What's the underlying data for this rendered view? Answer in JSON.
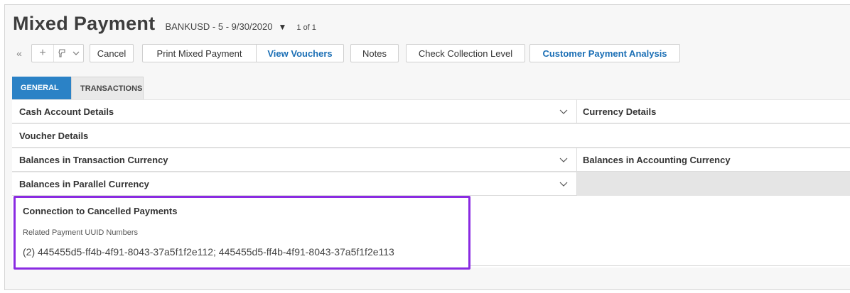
{
  "header": {
    "title": "Mixed Payment",
    "doc_ref": "BANKUSD - 5 - 9/30/2020",
    "doc_caret": "▼",
    "record_count": "1 of 1"
  },
  "toolbar": {
    "collapse_glyph": "«",
    "add_glyph": "+",
    "cancel": "Cancel",
    "print_mixed_payment": "Print Mixed Payment",
    "view_vouchers": "View Vouchers",
    "notes": "Notes",
    "check_collection_level": "Check Collection Level",
    "customer_payment_analysis": "Customer Payment Analysis"
  },
  "tabs": [
    {
      "label": "GENERAL",
      "active": true
    },
    {
      "label": "TRANSACTIONS",
      "active": false
    }
  ],
  "sections": {
    "cash_account_details": "Cash Account Details",
    "currency_details": "Currency Details",
    "voucher_details": "Voucher Details",
    "balances_transaction_currency": "Balances in Transaction Currency",
    "balances_accounting_currency": "Balances in Accounting Currency",
    "balances_parallel_currency": "Balances in Parallel Currency",
    "connection_cancelled_payments": "Connection to Cancelled Payments"
  },
  "connection": {
    "field_label": "Related Payment UUID Numbers",
    "field_value": "(2) 445455d5-ff4b-4f91-8043-37a5f1f2e112; 445455d5-ff4b-4f91-8043-37a5f1f2e113"
  },
  "colors": {
    "accent": "#2b82c6",
    "link": "#1b6fb5",
    "highlight": "#8a2be2"
  },
  "icons": {
    "collapse": "double-chevron-left-icon",
    "add": "plus-icon",
    "tool": "brush-icon",
    "dropdown": "chevron-down-icon"
  }
}
